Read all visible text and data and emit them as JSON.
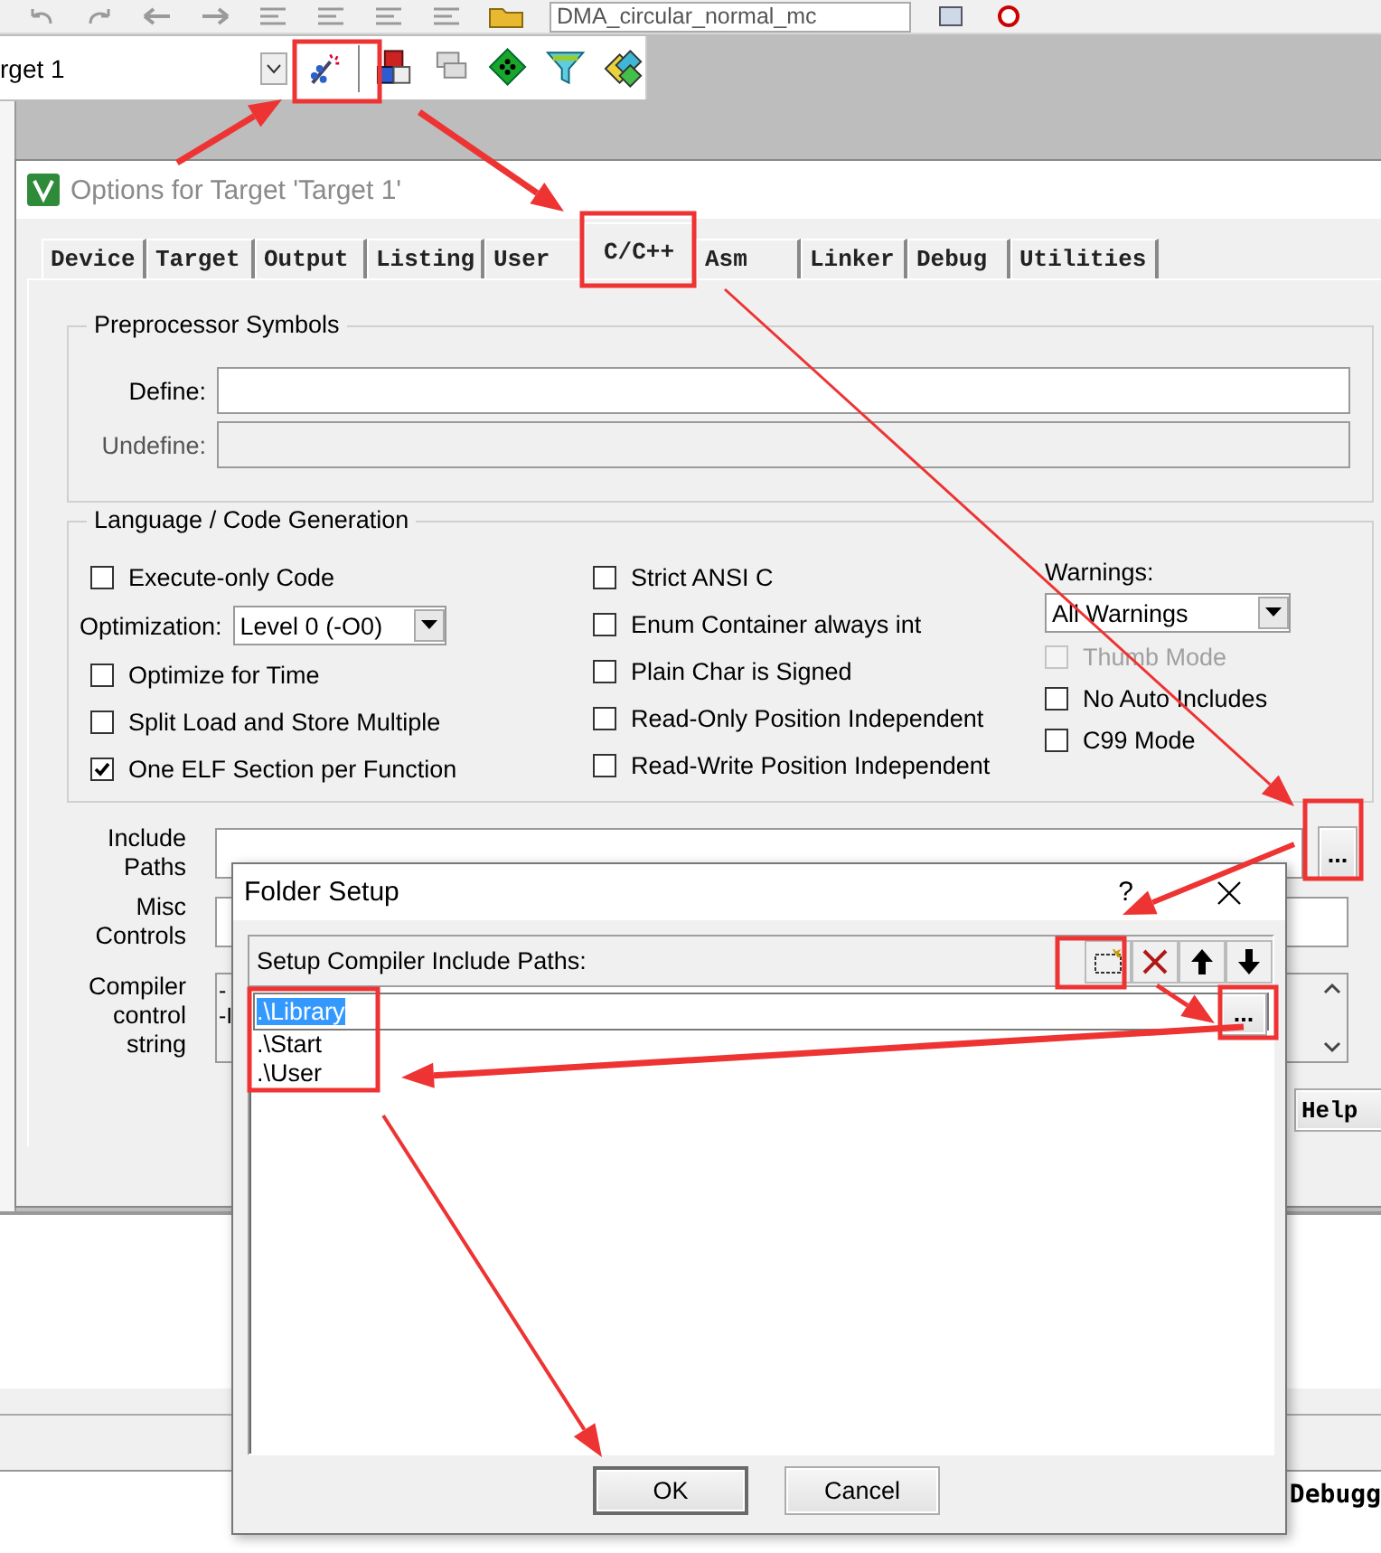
{
  "top_toolbar": {
    "project_combo": "DMA_circular_normal_mc"
  },
  "build_toolbar": {
    "target_combo": "rget 1"
  },
  "options_dialog": {
    "title": "Options for Target 'Target 1'",
    "tabs": [
      {
        "label": "Device",
        "selected": false
      },
      {
        "label": "Target",
        "selected": false
      },
      {
        "label": "Output",
        "selected": false
      },
      {
        "label": "Listing",
        "selected": false
      },
      {
        "label": "User",
        "selected": false
      },
      {
        "label": "C/C++",
        "selected": true
      },
      {
        "label": "Asm",
        "selected": false
      },
      {
        "label": "Linker",
        "selected": false
      },
      {
        "label": "Debug",
        "selected": false
      },
      {
        "label": "Utilities",
        "selected": false
      }
    ],
    "preprocessor_group": {
      "title": "Preprocessor Symbols",
      "define_label": "Define:",
      "undefine_label": "Undefine:"
    },
    "language_group": {
      "title": "Language / Code Generation",
      "column_1": [
        {
          "kind": "checkbox",
          "label": "Execute-only Code",
          "checked": false,
          "disabled": false
        },
        {
          "kind": "select",
          "label": "Optimization:",
          "value": "Level 0 (-O0)"
        },
        {
          "kind": "checkbox",
          "label": "Optimize for Time",
          "checked": false,
          "disabled": false
        },
        {
          "kind": "checkbox",
          "label": "Split Load and Store Multiple",
          "checked": false,
          "disabled": false
        },
        {
          "kind": "checkbox",
          "label": "One ELF Section per Function",
          "checked": true,
          "disabled": false
        }
      ],
      "column_2": [
        {
          "kind": "checkbox",
          "label": "Strict ANSI C",
          "checked": false,
          "disabled": false
        },
        {
          "kind": "checkbox",
          "label": "Enum Container always int",
          "checked": false,
          "disabled": false
        },
        {
          "kind": "checkbox",
          "label": "Plain Char is Signed",
          "checked": false,
          "disabled": false
        },
        {
          "kind": "checkbox",
          "label": "Read-Only Position Independent",
          "checked": false,
          "disabled": false
        },
        {
          "kind": "checkbox",
          "label": "Read-Write Position Independent",
          "checked": false,
          "disabled": false
        }
      ],
      "column_3": [
        {
          "kind": "label",
          "label": "Warnings:"
        },
        {
          "kind": "select",
          "value": "All Warnings"
        },
        {
          "kind": "checkbox",
          "label": "Thumb Mode",
          "checked": false,
          "disabled": true
        },
        {
          "kind": "checkbox",
          "label": "No Auto Includes",
          "checked": false,
          "disabled": false
        },
        {
          "kind": "checkbox",
          "label": "C99 Mode",
          "checked": false,
          "disabled": false
        }
      ]
    },
    "include_paths_label": "Include Paths",
    "include_browse": "...",
    "misc_controls_label": "Misc Controls",
    "compiler_string_label": "Compiler control string",
    "compiler_string_lines": [
      "-",
      "-I"
    ],
    "help_button": "Help"
  },
  "folder_setup": {
    "title": "Folder Setup",
    "help": "?",
    "header": "Setup Compiler Include Paths:",
    "paths": [
      {
        "text": ".\\Library",
        "selected": true
      },
      {
        "text": ".\\Start",
        "selected": false
      },
      {
        "text": ".\\User",
        "selected": false
      }
    ],
    "browse": "...",
    "buttons": [
      "OK",
      "Cancel"
    ]
  },
  "status_area": {
    "debug_tab": "Debugg"
  }
}
